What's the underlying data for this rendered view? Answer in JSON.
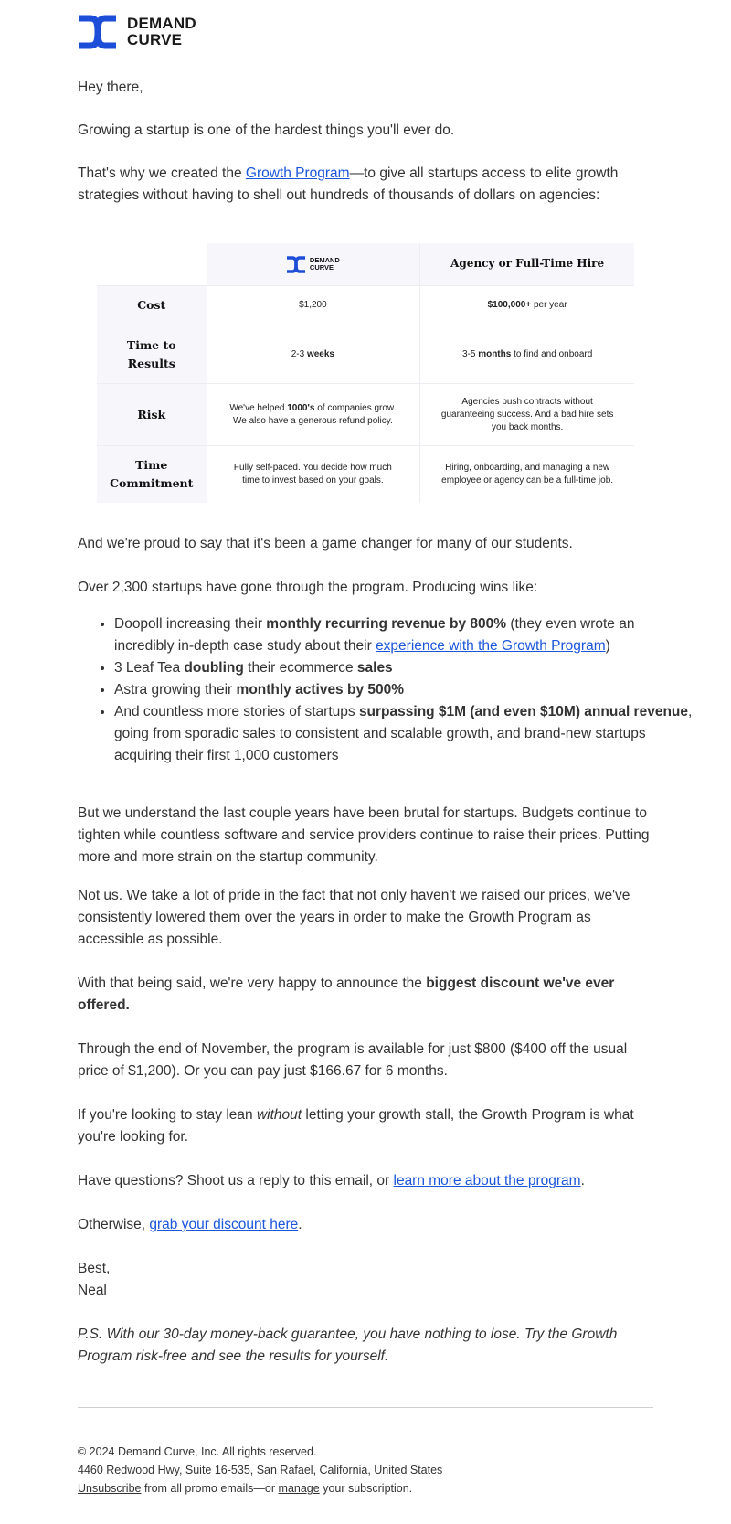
{
  "brand": {
    "name_line1": "DEMAND",
    "name_line2": "CURVE",
    "color": "#1d4ed8"
  },
  "email": {
    "greeting": "Hey there,",
    "p1": "Growing a startup is one of the hardest things you'll ever do.",
    "p2_pre": "That's why we created the ",
    "p2_link": "Growth Program",
    "p2_post": "—to give all startups access to elite growth strategies without having to shell out hundreds of thousands of dollars on agencies:",
    "p3": "And we're proud to say that it's been a game changer for many of our students.",
    "p4": "Over 2,300 startups have gone through the program. Producing wins like:",
    "wins": {
      "w1_pre": "Doopoll increasing their ",
      "w1_bold": "monthly recurring revenue by 800%",
      "w1_mid": " (they even wrote an incredibly in-depth case study about their ",
      "w1_link": "experience with the Growth Program",
      "w1_post": ")",
      "w2_pre": "3 Leaf Tea ",
      "w2_bold1": "doubling",
      "w2_mid": " their ecommerce ",
      "w2_bold2": "sales",
      "w3_pre": "Astra growing their ",
      "w3_bold": "monthly actives by 500%",
      "w4_pre": "And countless more stories of startups ",
      "w4_bold": "surpassing $1M (and even $10M) annual revenue",
      "w4_post": ", going from sporadic sales to consistent and scalable growth, and brand-new startups acquiring their first 1,000 customers"
    },
    "p5": "But we understand the last couple years have been brutal for startups. Budgets continue to tighten while countless software and service providers continue to raise their prices. Putting more and more strain on the startup community.",
    "p6": "Not us. We take a lot of pride in the fact that not only haven't we raised our prices, we've consistently lowered them over the years in order to make the Growth Program as accessible as possible.",
    "p7_pre": "With that being said, we're very happy to announce the ",
    "p7_bold": "biggest discount we've ever offered.",
    "p8": "Through the end of November, the program is available for just $800 ($400 off the usual price of $1,200). Or you can pay just $166.67 for 6 months.",
    "p9_pre": "If you're looking to stay lean ",
    "p9_em": "without",
    "p9_post": " letting your growth stall, the Growth Program is what you're looking for.",
    "p10_pre": "Have questions? Shoot us a reply to this email, or ",
    "p10_link": "learn more about the program",
    "p10_post": ".",
    "p11_pre": "Otherwise, ",
    "p11_link": "grab your discount here",
    "p11_post": ".",
    "signoff": "Best,",
    "signature": "Neal",
    "ps": "P.S. With our 30-day money-back guarantee, you have nothing to lose. Try the Growth Program risk-free and see the results for yourself."
  },
  "comparison": {
    "col2_header": "Agency or Full-Time Hire",
    "rows": [
      {
        "label": "Cost",
        "dc": "$1,200",
        "ag_bold": "$100,000+",
        "ag_rest": " per year"
      },
      {
        "label_l1": "Time to",
        "label_l2": "Results",
        "dc_pre": "2-3 ",
        "dc_bold": "weeks",
        "ag_pre": "3-5 ",
        "ag_bold": "months",
        "ag_rest": " to find and onboard"
      },
      {
        "label": "Risk",
        "dc_pre": "We've helped ",
        "dc_bold": "1000's",
        "dc_rest": " of companies grow.",
        "dc_l2": "We also have a generous refund policy.",
        "ag_l1": "Agencies push contracts without",
        "ag_l2": "guaranteeing success. And a bad hire sets",
        "ag_l3": "you back months."
      },
      {
        "label_l1": "Time",
        "label_l2": "Commitment",
        "dc_l1": "Fully self-paced. You decide how much",
        "dc_l2": "time to invest based on your goals.",
        "ag_l1": "Hiring, onboarding, and managing a new",
        "ag_l2": "employee or agency can be a full-time job."
      }
    ]
  },
  "footer": {
    "copyright": "© 2024 Demand Curve, Inc. All rights reserved.",
    "address": "4460 Redwood Hwy, Suite 16-535, San Rafael, California, United States",
    "unsubscribe": "Unsubscribe",
    "mid": " from all promo emails—or ",
    "manage": "manage",
    "post": " your subscription."
  }
}
